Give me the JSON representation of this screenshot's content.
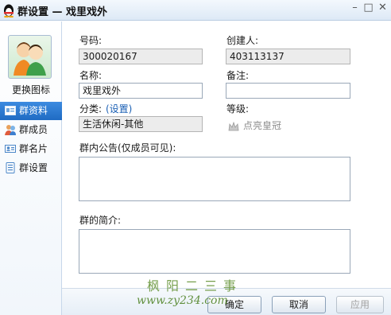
{
  "window": {
    "title": "群设置 — 戏里戏外",
    "min": "–",
    "max": "□",
    "close": "✕"
  },
  "sidebar": {
    "change_icon": "更换图标",
    "items": [
      {
        "label": "群资料",
        "icon": "group-info-icon"
      },
      {
        "label": "群成员",
        "icon": "group-members-icon"
      },
      {
        "label": "群名片",
        "icon": "group-card-icon"
      },
      {
        "label": "群设置",
        "icon": "group-settings-icon"
      }
    ]
  },
  "form": {
    "number_label": "号码:",
    "number_value": "300020167",
    "creator_label": "创建人:",
    "creator_value": "403113137",
    "name_label": "名称:",
    "name_value": "戏里戏外",
    "remark_label": "备注:",
    "remark_value": "",
    "category_label": "分类:",
    "category_link": "(设置)",
    "category_value": "生活休闲-其他",
    "level_label": "等级:",
    "level_link": "点亮皇冠",
    "notice_label": "群内公告(仅成员可见):",
    "notice_value": "",
    "intro_label": "群的简介:",
    "intro_value": ""
  },
  "buttons": {
    "ok": "确定",
    "cancel": "取消",
    "apply": "应用"
  },
  "watermark": {
    "line1": "枫阳二三事",
    "line2": "www.zy234.com"
  },
  "colors": {
    "active_nav": "#2a76cf",
    "link": "#1a5fb4"
  }
}
